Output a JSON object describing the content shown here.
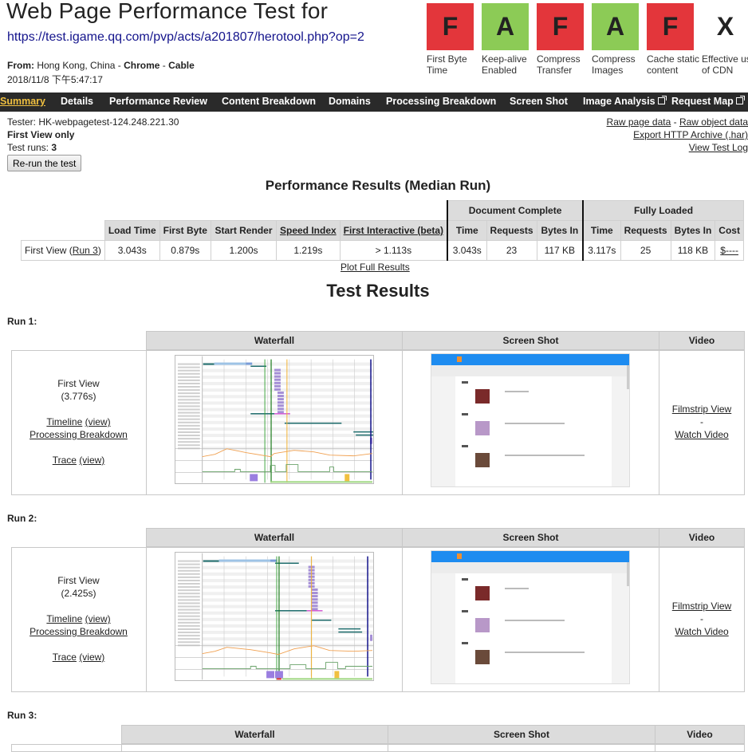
{
  "header": {
    "title": "Web Page Performance Test for",
    "url": "https://test.igame.qq.com/pvp/acts/a201807/herotool.php?op=2",
    "from_label": "From:",
    "from_location": "Hong Kong, China",
    "browser": "Chrome",
    "connection": "Cable",
    "separator": " - ",
    "date": "2018/11/8 下午5:47:17"
  },
  "grades": [
    {
      "grade": "F",
      "label": "First Byte Time",
      "color": "#e3363b"
    },
    {
      "grade": "A",
      "label": "Keep-alive Enabled",
      "color": "#8ccb56"
    },
    {
      "grade": "F",
      "label": "Compress Transfer",
      "color": "#e3363b"
    },
    {
      "grade": "A",
      "label": "Compress Images",
      "color": "#8ccb56"
    },
    {
      "grade": "F",
      "label": "Cache static content",
      "color": "#e3363b"
    },
    {
      "grade": "X",
      "label": "Effective use of CDN",
      "color": "#ffffff"
    }
  ],
  "nav": {
    "items": [
      {
        "label": "Summary",
        "active": true
      },
      {
        "label": "Details"
      },
      {
        "label": "Performance Review"
      },
      {
        "label": "Content Breakdown"
      },
      {
        "label": "Domains"
      },
      {
        "label": "Processing Breakdown"
      },
      {
        "label": "Screen Shot"
      },
      {
        "label": "Image Analysis",
        "external": true
      },
      {
        "label": "Request Map",
        "external": true
      }
    ]
  },
  "info": {
    "tester": "Tester: HK-webpagetest-124.248.221.30",
    "first_view_only": "First View only",
    "test_runs_label": "Test runs: ",
    "test_runs_value": "3",
    "rerun_button": "Re-run the test"
  },
  "links": {
    "raw_page_data": "Raw page data",
    "dash": " - ",
    "raw_object_data": "Raw object data",
    "export_har": "Export HTTP Archive (.har)",
    "view_test_log": "View Test Log"
  },
  "performance": {
    "title": "Performance Results (Median Run)",
    "group_headers": {
      "document_complete": "Document Complete",
      "fully_loaded": "Fully Loaded"
    },
    "columns": [
      "Load Time",
      "First Byte",
      "Start Render",
      "Speed Index",
      "First Interactive (beta)",
      "Time",
      "Requests",
      "Bytes In",
      "Time",
      "Requests",
      "Bytes In",
      "Cost"
    ],
    "row": {
      "label_prefix": "First View (",
      "run_link": "Run 3",
      "label_suffix": ")",
      "values": [
        "3.043s",
        "0.879s",
        "1.200s",
        "1.219s",
        "> 1.113s",
        "3.043s",
        "23",
        "117 KB",
        "3.117s",
        "25",
        "118 KB",
        "$----"
      ]
    },
    "plot_full_results": "Plot Full Results"
  },
  "test_results": {
    "title": "Test Results",
    "headers": {
      "waterfall": "Waterfall",
      "screen_shot": "Screen Shot",
      "video": "Video"
    },
    "runs": [
      {
        "label": "Run 1:",
        "view": "First View",
        "time": "(3.776s)",
        "timeline": "Timeline",
        "timeline_view": "(view)",
        "processing": "Processing Breakdown",
        "trace": "Trace",
        "trace_view": "(view)",
        "filmstrip": "Filmstrip View",
        "dash": "-",
        "watch_video": "Watch Video"
      },
      {
        "label": "Run 2:",
        "view": "First View",
        "time": "(2.425s)",
        "timeline": "Timeline",
        "timeline_view": "(view)",
        "processing": "Processing Breakdown",
        "trace": "Trace",
        "trace_view": "(view)",
        "filmstrip": "Filmstrip View",
        "dash": "-",
        "watch_video": "Watch Video"
      },
      {
        "label": "Run 3:"
      }
    ]
  }
}
